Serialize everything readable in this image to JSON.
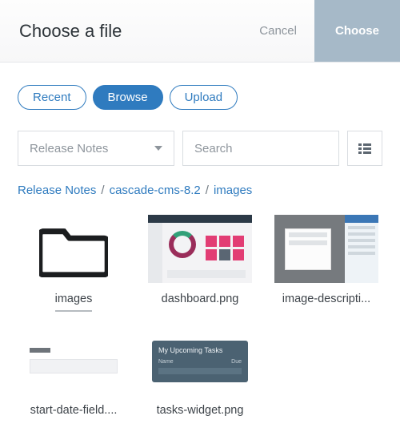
{
  "header": {
    "title": "Choose a file",
    "cancel": "Cancel",
    "choose": "Choose"
  },
  "tabs": {
    "recent": "Recent",
    "browse": "Browse",
    "upload": "Upload"
  },
  "controls": {
    "dropdown_value": "Release Notes",
    "search_placeholder": "Search"
  },
  "breadcrumb": {
    "a": "Release Notes",
    "b": "cascade-cms-8.2",
    "c": "images"
  },
  "files": {
    "f0": "images",
    "f1": "dashboard.png",
    "f2": "image-descripti...",
    "f3": "start-date-field....",
    "f4": "tasks-widget.png"
  }
}
